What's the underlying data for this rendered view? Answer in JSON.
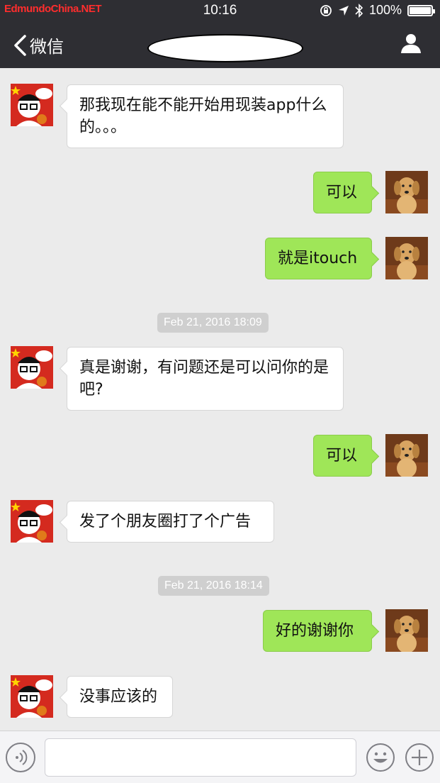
{
  "status_bar": {
    "carrier": "EdmundoChina.NET",
    "time": "10:16",
    "battery": "100%"
  },
  "nav": {
    "back_label": "微信",
    "icons": [
      "chevron-left-icon",
      "profile-icon"
    ]
  },
  "messages": [
    {
      "type": "in",
      "text": "那我现在能不能开始用现装app什么的。。。"
    },
    {
      "type": "out",
      "text": "可以"
    },
    {
      "type": "out",
      "text": "就是itouch"
    },
    {
      "type": "time",
      "text": "Feb 21, 2016 18:09"
    },
    {
      "type": "in",
      "text": "真是谢谢，有问题还是可以问你的是吧?"
    },
    {
      "type": "out",
      "text": "可以"
    },
    {
      "type": "in",
      "text": "发了个朋友圈打了个广告"
    },
    {
      "type": "time",
      "text": "Feb 21, 2016 18:14"
    },
    {
      "type": "out",
      "text": "好的谢谢你"
    },
    {
      "type": "in",
      "text": "没事应该的"
    }
  ],
  "input_bar": {
    "value": "",
    "icons": [
      "voice-icon",
      "emoji-icon",
      "plus-icon"
    ]
  },
  "colors": {
    "navbar": "#2e2e33",
    "background": "#ebebeb",
    "outgoing_bubble": "#9fe658",
    "incoming_bubble": "#ffffff",
    "timestamp_bg": "#cfcfcf"
  }
}
